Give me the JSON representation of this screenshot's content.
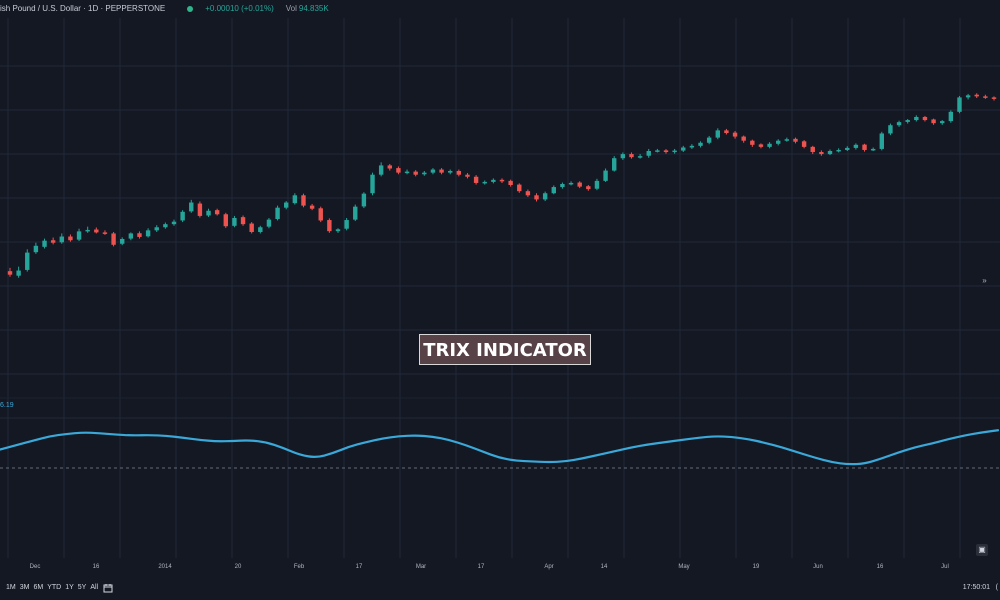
{
  "header": {
    "symbol_title": "ish Pound / U.S. Dollar · 1D · PEPPERSTONE",
    "change": "+0.00010 (+0.01%)",
    "volume_label": "Vol",
    "volume_value": "94.835K"
  },
  "indicator": {
    "name": "TRIX INDICATOR",
    "value": "6.19"
  },
  "time_axis": {
    "labels": [
      "Dec",
      "16",
      "2014",
      "20",
      "Feb",
      "17",
      "Mar",
      "17",
      "Apr",
      "14",
      "May",
      "19",
      "Jun",
      "16",
      "Jul"
    ]
  },
  "bottom_bar": {
    "ranges": [
      "1M",
      "3M",
      "6M",
      "YTD",
      "1Y",
      "5Y",
      "All"
    ],
    "clock": "17:50:01",
    "clock_tail": "("
  },
  "colors": {
    "background": "#141823",
    "grid": "#22283a",
    "bullish": "#26a69a",
    "bearish": "#ef5350",
    "trix_line": "#3aa8d8",
    "badge_bg": "#574247"
  },
  "icons": {
    "status": "status-dot-icon",
    "chevron": "double-chevron-right-icon",
    "calendar": "calendar-icon",
    "pane_control": "pane-control-icon"
  },
  "chart_data": {
    "type": "line",
    "price": {
      "close": [
        1.6195,
        1.6215,
        1.6302,
        1.6335,
        1.636,
        1.635,
        1.638,
        1.6362,
        1.6405,
        1.6412,
        1.64,
        1.6395,
        1.634,
        1.6368,
        1.6395,
        1.6378,
        1.641,
        1.6425,
        1.644,
        1.6452,
        1.65,
        1.6545,
        1.648,
        1.6505,
        1.6488,
        1.643,
        1.647,
        1.644,
        1.6402,
        1.6425,
        1.6462,
        1.652,
        1.6545,
        1.658,
        1.653,
        1.6515,
        1.6458,
        1.6406,
        1.6415,
        1.646,
        1.6525,
        1.6588,
        1.668,
        1.6725,
        1.671,
        1.669,
        1.6695,
        1.668,
        1.669,
        1.6705,
        1.669,
        1.6698,
        1.668,
        1.667,
        1.664,
        1.6645,
        1.6655,
        1.6648,
        1.663,
        1.66,
        1.658,
        1.656,
        1.659,
        1.662,
        1.6635,
        1.664,
        1.6622,
        1.661,
        1.665,
        1.67,
        1.676,
        1.678,
        1.6765,
        1.677,
        1.6795,
        1.6798,
        1.679,
        1.6797,
        1.6812,
        1.682,
        1.6835,
        1.686,
        1.6895,
        1.6882,
        1.6865,
        1.6845,
        1.6825,
        1.6815,
        1.683,
        1.6845,
        1.6852,
        1.684,
        1.6815,
        1.679,
        1.678,
        1.6795,
        1.68,
        1.681,
        1.6825,
        1.68,
        1.6805,
        1.688,
        1.692,
        1.6935,
        1.6945,
        1.696,
        1.6945,
        1.693,
        1.694,
        1.6985,
        1.7055,
        1.7065,
        1.706,
        1.7055,
        1.705
      ],
      "open": [
        1.6212,
        1.619,
        1.6218,
        1.6304,
        1.633,
        1.6362,
        1.6352,
        1.638,
        1.6365,
        1.6405,
        1.6414,
        1.64,
        1.6395,
        1.6345,
        1.637,
        1.6396,
        1.6381,
        1.641,
        1.6425,
        1.644,
        1.6458,
        1.6502,
        1.654,
        1.6482,
        1.6508,
        1.6488,
        1.6432,
        1.6474,
        1.6443,
        1.6402,
        1.6428,
        1.6465,
        1.652,
        1.6542,
        1.658,
        1.653,
        1.6517,
        1.646,
        1.6406,
        1.6418,
        1.6462,
        1.6526,
        1.659,
        1.668,
        1.6725,
        1.6712,
        1.669,
        1.6695,
        1.6682,
        1.669,
        1.6705,
        1.669,
        1.6698,
        1.668,
        1.667,
        1.664,
        1.6645,
        1.6655,
        1.665,
        1.6632,
        1.66,
        1.658,
        1.656,
        1.659,
        1.662,
        1.6637,
        1.6642,
        1.6624,
        1.6612,
        1.665,
        1.67,
        1.676,
        1.678,
        1.6765,
        1.6772,
        1.6795,
        1.6798,
        1.679,
        1.6797,
        1.6812,
        1.682,
        1.6835,
        1.686,
        1.6895,
        1.6884,
        1.6865,
        1.6845,
        1.6827,
        1.6815,
        1.683,
        1.6845,
        1.6854,
        1.6842,
        1.6815,
        1.679,
        1.678,
        1.6795,
        1.68,
        1.681,
        1.6826,
        1.68,
        1.6805,
        1.688,
        1.692,
        1.6936,
        1.6945,
        1.696,
        1.6948,
        1.693,
        1.694,
        1.6985,
        1.7055,
        1.7068,
        1.706,
        1.7055
      ],
      "high": [
        1.6228,
        1.6234,
        1.6318,
        1.635,
        1.637,
        1.6375,
        1.6395,
        1.639,
        1.6418,
        1.6428,
        1.6424,
        1.641,
        1.6402,
        1.6376,
        1.64,
        1.6405,
        1.642,
        1.6435,
        1.6448,
        1.6462,
        1.6508,
        1.6558,
        1.655,
        1.6515,
        1.6515,
        1.6495,
        1.648,
        1.6482,
        1.645,
        1.6432,
        1.647,
        1.653,
        1.6552,
        1.659,
        1.6588,
        1.6538,
        1.6525,
        1.6468,
        1.642,
        1.647,
        1.6535,
        1.6595,
        1.669,
        1.674,
        1.6732,
        1.672,
        1.6705,
        1.6702,
        1.6698,
        1.6712,
        1.6712,
        1.6705,
        1.6705,
        1.6688,
        1.6678,
        1.6652,
        1.6662,
        1.6662,
        1.6656,
        1.6638,
        1.6608,
        1.659,
        1.6598,
        1.6628,
        1.6642,
        1.6648,
        1.6648,
        1.663,
        1.666,
        1.671,
        1.677,
        1.6788,
        1.6788,
        1.678,
        1.6805,
        1.6805,
        1.6804,
        1.6805,
        1.682,
        1.6828,
        1.6842,
        1.6868,
        1.6905,
        1.6902,
        1.6892,
        1.687,
        1.685,
        1.6832,
        1.6838,
        1.6852,
        1.686,
        1.686,
        1.6848,
        1.682,
        1.6798,
        1.6802,
        1.6808,
        1.6818,
        1.6832,
        1.683,
        1.6812,
        1.6888,
        1.6928,
        1.6942,
        1.695,
        1.6968,
        1.6965,
        1.6952,
        1.6945,
        1.6992,
        1.7062,
        1.7072,
        1.7075,
        1.7068,
        1.706
      ],
      "low": [
        1.6185,
        1.618,
        1.621,
        1.6296,
        1.6322,
        1.6342,
        1.6345,
        1.6355,
        1.6358,
        1.6398,
        1.6395,
        1.6388,
        1.6332,
        1.6338,
        1.6362,
        1.637,
        1.6375,
        1.6402,
        1.6418,
        1.6432,
        1.645,
        1.6495,
        1.6472,
        1.6475,
        1.6482,
        1.6422,
        1.6425,
        1.6432,
        1.6395,
        1.6395,
        1.642,
        1.6458,
        1.6512,
        1.6535,
        1.6522,
        1.6508,
        1.645,
        1.6398,
        1.6398,
        1.641,
        1.6455,
        1.6518,
        1.658,
        1.6672,
        1.67,
        1.6682,
        1.6682,
        1.6672,
        1.6675,
        1.6682,
        1.6682,
        1.6682,
        1.6672,
        1.6662,
        1.6632,
        1.6632,
        1.6638,
        1.664,
        1.6622,
        1.6592,
        1.6572,
        1.655,
        1.6552,
        1.6585,
        1.6612,
        1.6628,
        1.6615,
        1.6602,
        1.6605,
        1.6645,
        1.6695,
        1.6752,
        1.6758,
        1.6758,
        1.6762,
        1.6788,
        1.6782,
        1.6782,
        1.679,
        1.6805,
        1.6812,
        1.6828,
        1.6852,
        1.6875,
        1.6855,
        1.6835,
        1.6815,
        1.6808,
        1.6808,
        1.6822,
        1.684,
        1.6832,
        1.6808,
        1.678,
        1.6772,
        1.6775,
        1.6788,
        1.6795,
        1.6802,
        1.6792,
        1.6795,
        1.6798,
        1.6872,
        1.6912,
        1.6928,
        1.6938,
        1.6938,
        1.6922,
        1.6922,
        1.6932,
        1.6978,
        1.7045,
        1.7052,
        1.7048,
        1.704
      ]
    },
    "trix": [
      0.5,
      0.62,
      0.74,
      0.86,
      0.92,
      0.96,
      0.94,
      0.9,
      0.88,
      0.89,
      0.87,
      0.82,
      0.76,
      0.72,
      0.73,
      0.75,
      0.7,
      0.55,
      0.36,
      0.28,
      0.4,
      0.58,
      0.7,
      0.8,
      0.86,
      0.88,
      0.85,
      0.76,
      0.62,
      0.45,
      0.28,
      0.2,
      0.18,
      0.16,
      0.18,
      0.26,
      0.36,
      0.46,
      0.56,
      0.64,
      0.7,
      0.76,
      0.82,
      0.86,
      0.84,
      0.78,
      0.68,
      0.56,
      0.42,
      0.28,
      0.16,
      0.1,
      0.12,
      0.26,
      0.42,
      0.56,
      0.66,
      0.78,
      0.88,
      0.96,
      1.02
    ],
    "trix_zero": 0,
    "price_ylim": [
      1.614,
      1.712
    ],
    "trix_ylim": [
      -0.05,
      1.08
    ],
    "grid": true,
    "legend_position": "none"
  }
}
